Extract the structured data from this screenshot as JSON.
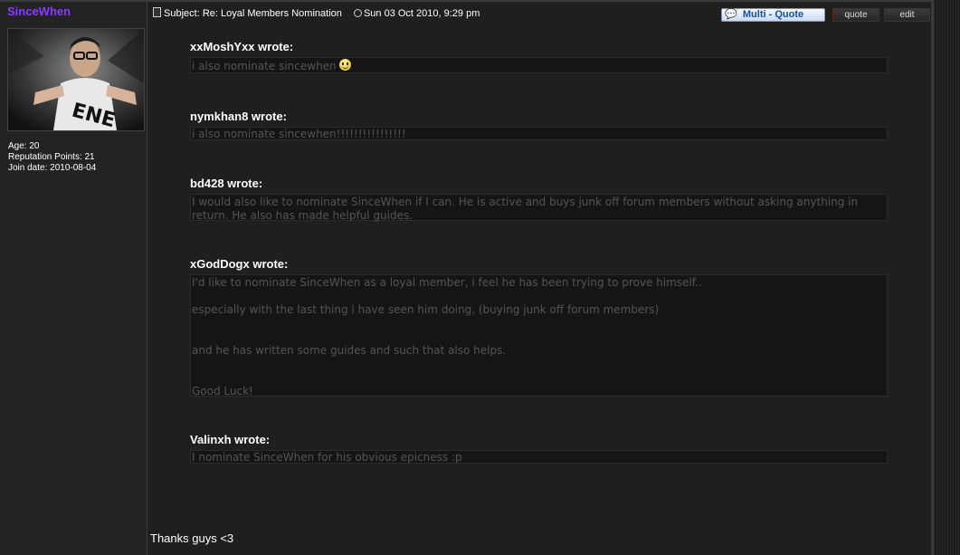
{
  "profile": {
    "username": "SinceWhen",
    "age_label": "Age:",
    "age": "20",
    "rep_label": "Reputation Points:",
    "rep": "21",
    "join_label": "Join date:",
    "join": "2010-08-04"
  },
  "post": {
    "subject_label": "Subject:",
    "subject": "Re: Loyal Members Nomination",
    "date": "Sun 03 Oct 2010, 9:29 pm",
    "multi_quote_label": "Multi - Quote",
    "quote_label": "quote",
    "edit_label": "edit",
    "closing": "Thanks guys <3"
  },
  "quotes": [
    {
      "author": "xxMoshYxx wrote:",
      "lines": [
        "i also nominate sincewhen"
      ]
    },
    {
      "author": "nymkhan8 wrote:",
      "lines": [
        "i also nominate sincewhen!!!!!!!!!!!!!!!!"
      ]
    },
    {
      "author": "bd428 wrote:",
      "lines": [
        "I would also like to nominate SinceWhen if I can. He is active and buys junk off forum members without asking anything in return. He also has made helpful guides."
      ]
    },
    {
      "author": "xGodDogx wrote:",
      "lines": [
        "I'd like to nominate SinceWhen as a loyal member, i feel he has been trying to prove himself..",
        "especially with the last thing i have seen him doing, (buying junk off forum members)",
        "and he has written some guides and such that also helps.",
        "Good Luck!"
      ]
    },
    {
      "author": "Valinxh wrote:",
      "lines": [
        "I nominate SinceWhen for his obvious epicness :p"
      ]
    }
  ]
}
